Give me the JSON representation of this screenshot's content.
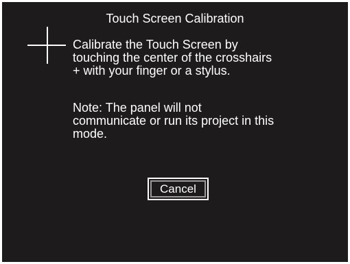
{
  "window": {
    "title": "Touch Screen Calibration"
  },
  "crosshair": {
    "icon": "crosshair-icon"
  },
  "instructions": {
    "lines": [
      "Calibrate the Touch Screen by",
      "touching the center of the crosshairs",
      "+ with your finger or a stylus."
    ]
  },
  "note": {
    "lines": [
      "Note: The panel will not",
      "communicate or run its project in this",
      "mode."
    ]
  },
  "buttons": {
    "cancel_label": "Cancel"
  },
  "colors": {
    "background": "#1d1b1b",
    "text": "#ffffff",
    "button_inner_border": "#9a9a9a"
  }
}
